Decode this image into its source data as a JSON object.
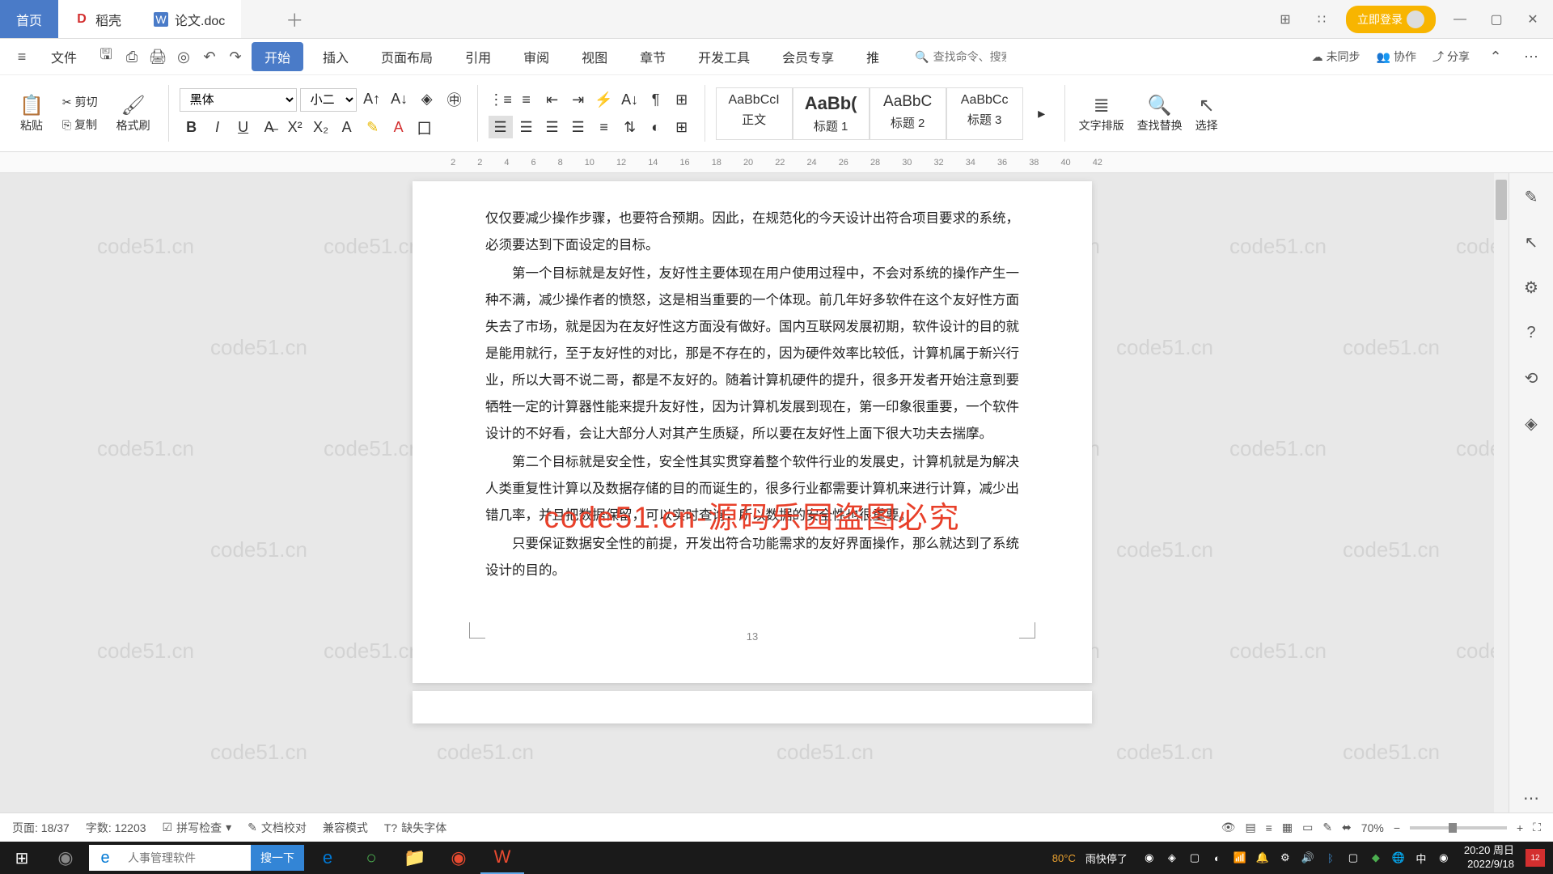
{
  "titlebar": {
    "tabs": [
      {
        "label": "首页",
        "type": "home"
      },
      {
        "label": "稻壳",
        "icon": "D"
      },
      {
        "label": "论文.doc",
        "icon": "W"
      }
    ],
    "login": "立即登录"
  },
  "menubar": {
    "file": "文件",
    "items": [
      "开始",
      "插入",
      "页面布局",
      "引用",
      "审阅",
      "视图",
      "章节",
      "开发工具",
      "会员专享",
      "推"
    ],
    "search_placeholder": "查找命令、搜索模板",
    "right": {
      "sync": "未同步",
      "collab": "协作",
      "share": "分享"
    }
  },
  "ribbon": {
    "paste": "粘贴",
    "cut": "剪切",
    "copy": "复制",
    "format_painter": "格式刷",
    "font_name": "黑体",
    "font_size": "小二",
    "styles": [
      {
        "preview": "AaBbCcI",
        "name": "正文"
      },
      {
        "preview": "AaBb(",
        "name": "标题 1"
      },
      {
        "preview": "AaBbC",
        "name": "标题 2"
      },
      {
        "preview": "AaBbCc",
        "name": "标题 3"
      }
    ],
    "text_layout": "文字排版",
    "find_replace": "查找替换",
    "select": "选择"
  },
  "ruler_marks": [
    "2",
    "2",
    "4",
    "6",
    "8",
    "10",
    "12",
    "14",
    "16",
    "18",
    "20",
    "22",
    "24",
    "26",
    "28",
    "30",
    "32",
    "34",
    "36",
    "38",
    "40",
    "42"
  ],
  "document": {
    "p1": "仅仅要减少操作步骤，也要符合预期。因此，在规范化的今天设计出符合项目要求的系统，必须要达到下面设定的目标。",
    "p2": "第一个目标就是友好性，友好性主要体现在用户使用过程中，不会对系统的操作产生一种不满，减少操作者的愤怒，这是相当重要的一个体现。前几年好多软件在这个友好性方面失去了市场，就是因为在友好性这方面没有做好。国内互联网发展初期，软件设计的目的就是能用就行，至于友好性的对比，那是不存在的，因为硬件效率比较低，计算机属于新兴行业，所以大哥不说二哥，都是不友好的。随着计算机硬件的提升，很多开发者开始注意到要牺牲一定的计算器性能来提升友好性，因为计算机发展到现在，第一印象很重要，一个软件设计的不好看，会让大部分人对其产生质疑，所以要在友好性上面下很大功夫去揣摩。",
    "p3": "第二个目标就是安全性，安全性其实贯穿着整个软件行业的发展史，计算机就是为解决人类重复性计算以及数据存储的目的而诞生的，很多行业都需要计算机来进行计算，减少出错几率，并且把数据保留，可以实时查询，所以数据的安全性也很重要。",
    "p4": "只要保证数据安全性的前提，开发出符合功能需求的友好界面操作，那么就达到了系统设计的目的。",
    "watermark": "code51.cn-源码乐园盗图必究",
    "bg_wm": "code51.cn",
    "page_indicator": "13"
  },
  "statusbar": {
    "page": "页面: 18/37",
    "words": "字数: 12203",
    "spellcheck": "拼写检查",
    "proofread": "文档校对",
    "compat": "兼容模式",
    "missing_font": "缺失字体",
    "zoom": "70%"
  },
  "taskbar": {
    "search_placeholder": "人事管理软件",
    "search_btn": "搜一下",
    "temp": "80°C",
    "weather": "雨快停了",
    "time": "20:20 周日",
    "date": "2022/9/18",
    "notif_count": "12"
  }
}
